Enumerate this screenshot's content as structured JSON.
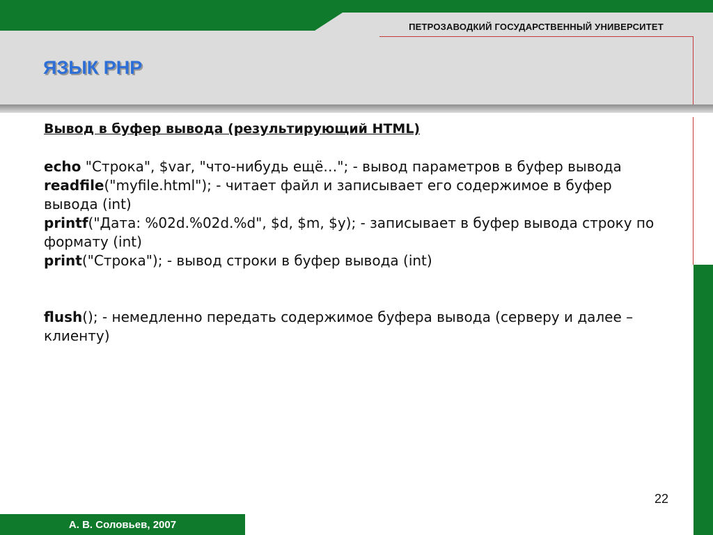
{
  "header": {
    "university": "ПЕТРОЗАВОДКИЙ ГОСУДАРСТВЕННЫЙ УНИВЕРСИТЕТ",
    "title": "ЯЗЫК PHP"
  },
  "body": {
    "heading": "Вывод в буфер вывода (результирующий HTML)",
    "items": [
      {
        "kw": "echo",
        "text": " \"Строка\", $var, \"что-нибудь ещё…\"; - вывод параметров в буфер вывода"
      },
      {
        "kw": "readfile",
        "text": "(\"myfile.html\"); - читает файл и записывает его содержимое в буфер вывода (int)"
      },
      {
        "kw": "printf",
        "text": "(\"Дата: %02d.%02d.%d\", $d, $m, $y); - записывает в буфер вывода строку по формату (int)"
      },
      {
        "kw": "print",
        "text": "(\"Строка\"); - вывод строки в буфер вывода (int)"
      }
    ],
    "flush": {
      "kw": "flush",
      "text": "(); - немедленно передать содержимое буфера вывода (серверу и далее – клиенту)"
    }
  },
  "footer": {
    "page_number": "22",
    "author": "А. В. Соловьев, 2007"
  },
  "colors": {
    "green": "#0f7a2b",
    "gray": "#dcdcdc",
    "title_blue": "#2d6fd6",
    "accent_red": "#c23b3b"
  }
}
